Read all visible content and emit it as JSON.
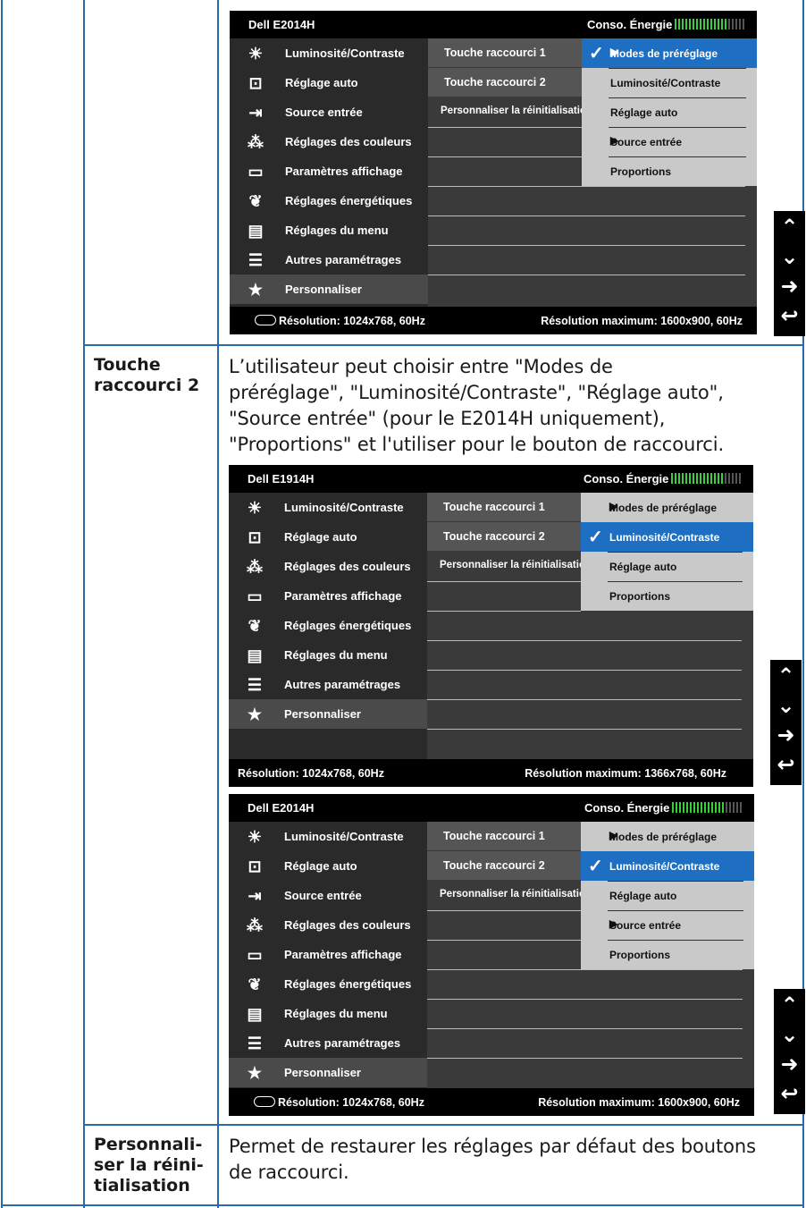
{
  "rows": [
    {
      "label": "Touche\nraccourci 2",
      "text": "L’utilisateur peut choisir entre \"Modes de préréglage\", \"Luminosité/Contraste\", \"Réglage auto\", \"Source entrée\" (pour le E2014H uniquement), \"Proportions\" et l'utiliser pour le bouton de raccourci."
    },
    {
      "label": "Personnali-\nser la réini-\ntialisation",
      "text": "Permet de restaurer les réglages par défaut des boutons de raccourci."
    }
  ],
  "para1_lines": [
    "L’utilisateur peut choisir entre \"Modes de",
    "préréglage\", \"Luminosité/Contraste\", \"Réglage auto\",",
    "\"Source entrée\" (pour le E2014H uniquement),",
    "\"Proportions\" et l'utiliser pour le bouton de raccourci."
  ],
  "para2_lines": [
    "Permet de restaurer les réglages par défaut des boutons",
    "de raccourci."
  ],
  "label1_lines": [
    "Touche",
    "raccourci 2"
  ],
  "label2_lines": [
    "Personnali-",
    "ser la réini-",
    "tialisation"
  ],
  "osds": [
    {
      "model": "Dell E2014H",
      "energy": "Conso. Énergie",
      "menu": [
        "Luminosité/Contraste",
        "Réglage auto",
        "Source entrée",
        "Réglages des couleurs",
        "Paramètres affichage",
        "Réglages énergétiques",
        "Réglages du menu",
        "Autres paramétrages",
        "Personnaliser"
      ],
      "menu_icons": [
        "brightness-icon",
        "auto-adjust-icon",
        "input-source-icon",
        "color-icon",
        "display-icon",
        "energy-leaf-icon",
        "menu-icon",
        "other-settings-icon",
        "star-icon"
      ],
      "mid": [
        "Touche raccourci 1",
        "Touche raccourci 2",
        "Personnaliser la réinitialisation"
      ],
      "options": [
        "Modes de préréglage",
        "Luminosité/Contraste",
        "Réglage auto",
        "Source entrée",
        "Proportions"
      ],
      "selected_option": 0,
      "resolution": "Résolution: 1024x768, 60Hz",
      "max_resolution": "Résolution maximum: 1600x900, 60Hz"
    },
    {
      "model": "Dell E1914H",
      "energy": "Conso. Énergie",
      "menu": [
        "Luminosité/Contraste",
        "Réglage auto",
        "Réglages des couleurs",
        "Paramètres affichage",
        "Réglages énergétiques",
        "Réglages du menu",
        "Autres paramétrages",
        "Personnaliser"
      ],
      "menu_icons": [
        "brightness-icon",
        "auto-adjust-icon",
        "color-icon",
        "display-icon",
        "energy-leaf-icon",
        "menu-icon",
        "other-settings-icon",
        "star-icon"
      ],
      "mid": [
        "Touche raccourci 1",
        "Touche raccourci 2",
        "Personnaliser la réinitialisation"
      ],
      "options": [
        "Modes de préréglage",
        "Luminosité/Contraste",
        "Réglage auto",
        "Proportions"
      ],
      "selected_option": 1,
      "resolution": "Résolution: 1024x768, 60Hz",
      "max_resolution": "Résolution maximum: 1366x768, 60Hz"
    },
    {
      "model": "Dell E2014H",
      "energy": "Conso. Énergie",
      "menu": [
        "Luminosité/Contraste",
        "Réglage auto",
        "Source entrée",
        "Réglages des couleurs",
        "Paramètres affichage",
        "Réglages énergétiques",
        "Réglages du menu",
        "Autres paramétrages",
        "Personnaliser"
      ],
      "menu_icons": [
        "brightness-icon",
        "auto-adjust-icon",
        "input-source-icon",
        "color-icon",
        "display-icon",
        "energy-leaf-icon",
        "menu-icon",
        "other-settings-icon",
        "star-icon"
      ],
      "mid": [
        "Touche raccourci 1",
        "Touche raccourci 2",
        "Personnaliser la réinitialisation"
      ],
      "options": [
        "Modes de préréglage",
        "Luminosité/Contraste",
        "Réglage auto",
        "Source entrée",
        "Proportions"
      ],
      "selected_option": 1,
      "resolution": "Résolution: 1024x768, 60Hz",
      "max_resolution": "Résolution maximum: 1600x900, 60Hz"
    }
  ],
  "nav_buttons": [
    "up-arrow-icon",
    "down-arrow-icon",
    "right-arrow-icon",
    "back-icon"
  ],
  "colors": {
    "border": "#2a6ca8",
    "highlight": "#1e6fc2",
    "energy_bar": "#36d13a"
  }
}
